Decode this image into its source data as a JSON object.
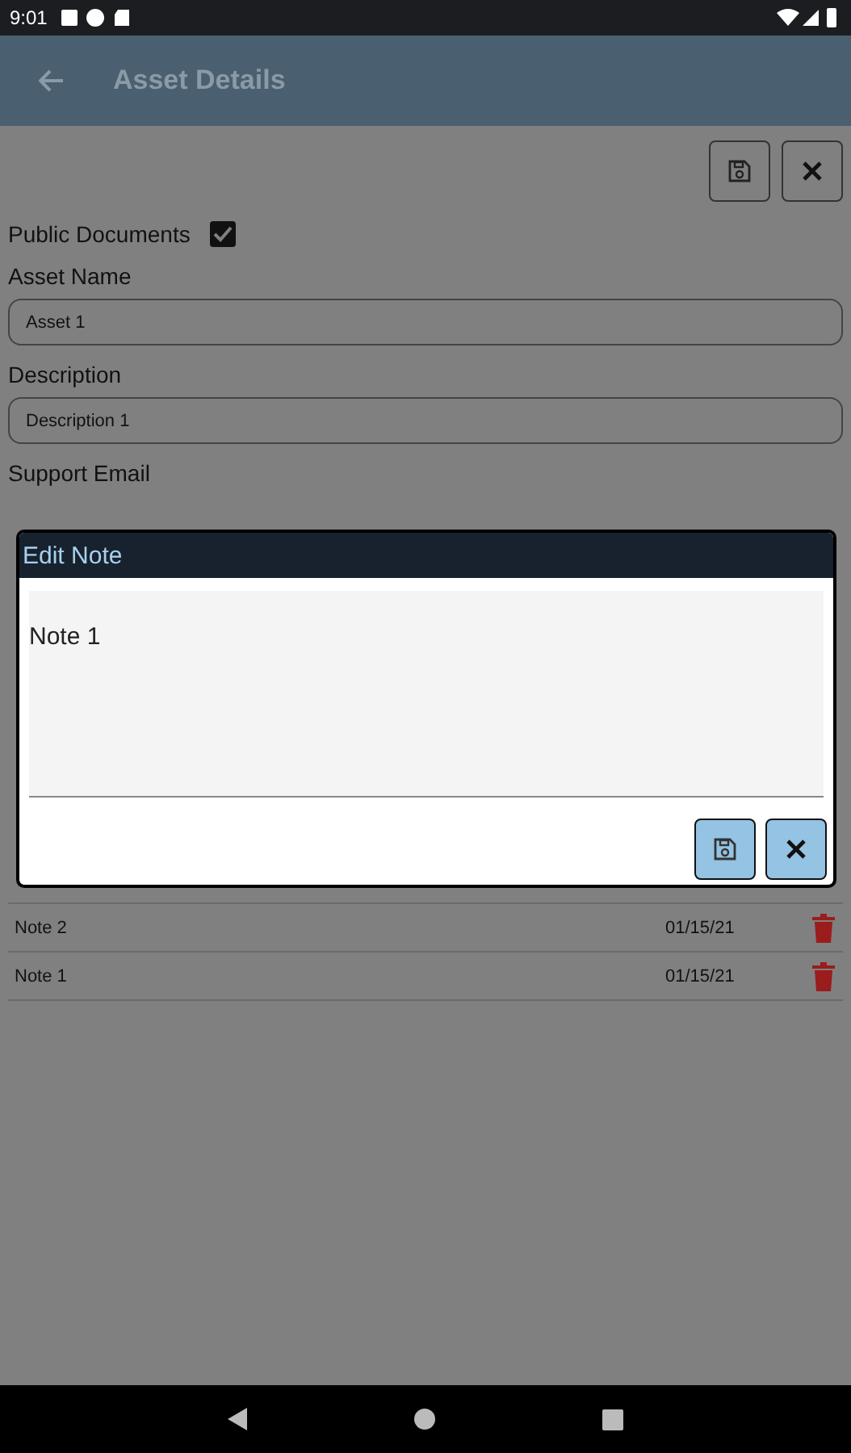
{
  "status_bar": {
    "time": "9:01"
  },
  "app_bar": {
    "title": "Asset Details"
  },
  "public_documents": {
    "label": "Public Documents",
    "checked": true
  },
  "fields": [
    {
      "label": "Asset Name",
      "value": "Asset 1"
    },
    {
      "label": "Description",
      "value": "Description 1"
    }
  ],
  "support_email": {
    "label": "Support Email"
  },
  "notes": [
    {
      "name": "Note 2",
      "date": "01/15/21"
    },
    {
      "name": "Note 1",
      "date": "01/15/21"
    }
  ],
  "dialog": {
    "title": "Edit Note",
    "value": "Note 1"
  }
}
